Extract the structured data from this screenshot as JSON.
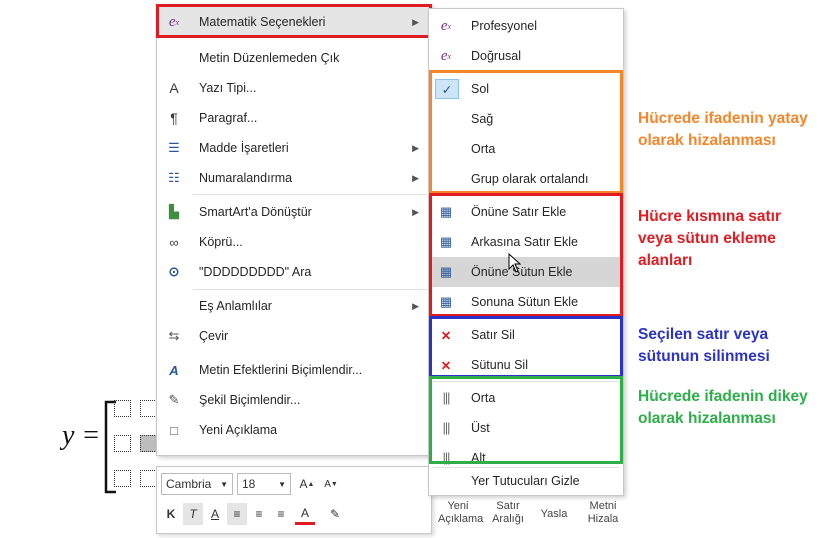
{
  "equation": {
    "lhs": "y ="
  },
  "context_menu": {
    "items": [
      {
        "label": "Matematik Seçenekleri",
        "icon": "math-options-icon",
        "submenu": true
      },
      {
        "label": "Metin Düzenlemeden Çık",
        "icon": "",
        "submenu": false
      },
      {
        "label": "Yazı Tipi...",
        "icon": "font-icon",
        "submenu": false
      },
      {
        "label": "Paragraf...",
        "icon": "paragraph-icon",
        "submenu": false
      },
      {
        "label": "Madde İşaretleri",
        "icon": "bullets-icon",
        "submenu": true
      },
      {
        "label": "Numaralandırma",
        "icon": "numbering-icon",
        "submenu": true
      },
      {
        "label": "SmartArt'a Dönüştür",
        "icon": "smartart-icon",
        "submenu": true
      },
      {
        "label": "Köprü...",
        "icon": "link-icon",
        "submenu": false
      },
      {
        "label": "\"DDDDDDDDD\" Ara",
        "icon": "search-icon",
        "submenu": false
      },
      {
        "label": "Eş Anlamlılar",
        "icon": "",
        "submenu": true
      },
      {
        "label": "Çevir",
        "icon": "translate-icon",
        "submenu": false
      },
      {
        "label": "Metin Efektlerini Biçimlendir...",
        "icon": "text-effects-icon",
        "submenu": false
      },
      {
        "label": "Şekil Biçimlendir...",
        "icon": "format-shape-icon",
        "submenu": false
      },
      {
        "label": "Yeni Açıklama",
        "icon": "comment-icon",
        "submenu": false
      }
    ]
  },
  "submenu": {
    "items": [
      {
        "label": "Profesyonel",
        "icon": "math-professional-icon"
      },
      {
        "label": "Doğrusal",
        "icon": "math-linear-icon"
      },
      {
        "label": "Sol",
        "icon": "checkmark-icon",
        "checked": true
      },
      {
        "label": "Sağ",
        "icon": ""
      },
      {
        "label": "Orta",
        "icon": ""
      },
      {
        "label": "Grup olarak ortalandı",
        "icon": ""
      },
      {
        "label": "Önüne Satır Ekle",
        "icon": "insert-row-above-icon"
      },
      {
        "label": "Arkasına Satır Ekle",
        "icon": "insert-row-below-icon"
      },
      {
        "label": "Önüne Sütun Ekle",
        "icon": "insert-column-left-icon",
        "highlighted": true
      },
      {
        "label": "Sonuna Sütun Ekle",
        "icon": "insert-column-right-icon"
      },
      {
        "label": "Satır Sil",
        "icon": "delete-row-icon"
      },
      {
        "label": "Sütunu Sil",
        "icon": "delete-column-icon"
      },
      {
        "label": "Orta",
        "icon": "align-middle-icon"
      },
      {
        "label": "Üst",
        "icon": "align-top-icon"
      },
      {
        "label": "Alt",
        "icon": "align-bottom-icon"
      },
      {
        "label": "Yer Tutucuları Gizle",
        "icon": ""
      }
    ]
  },
  "annotations": {
    "horizontal": "Hücrede ifadenin yatay olarak hizalanması",
    "insert": "Hücre kısmına satır veya sütun ekleme alanları",
    "delete": "Seçilen satır veya sütunun silinmesi",
    "vertical": "Hücrede ifadenin dikey olarak hizalanması"
  },
  "mini_toolbar": {
    "font": "Cambria",
    "size": "18",
    "buttons": [
      {
        "label": "Yeni Açıklama"
      },
      {
        "label": "Satır Aralığı"
      },
      {
        "label": "Yasla"
      },
      {
        "label": "Metni Hizala"
      }
    ]
  },
  "colors": {
    "red": "#e11b22",
    "orange": "#f5862a",
    "blue": "#2b33c6",
    "green": "#2eae49"
  }
}
